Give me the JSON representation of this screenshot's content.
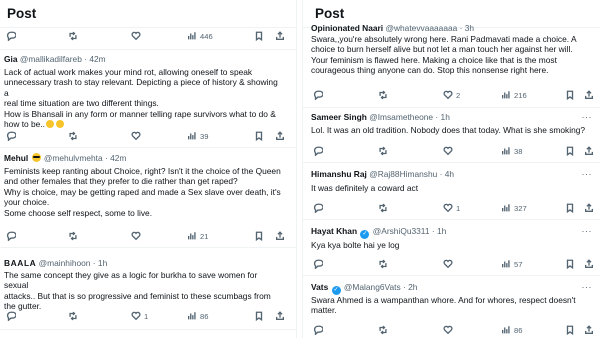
{
  "left": {
    "title": "Post",
    "top_actions": {
      "views": "446"
    },
    "posts": [
      {
        "name": "Gia",
        "handle": "@mallikadilfareb",
        "time": "42m",
        "lines": [
          "Lack of actual work makes your mind rot, allowing oneself to speak",
          "unnecessary trash to stay relevant. Depicting a piece of history & showing a",
          "real time situation are two different things.",
          "How is Bhansali in any form or manner telling rape survivors what to do &",
          "how to be.."
        ],
        "views": "39"
      },
      {
        "name": "Mehul",
        "handle": "@mehulvmehta",
        "time": "42m",
        "lines": [
          "Feminists keep ranting about Choice, right? Isn't it the choice of the Queen",
          "and other females that they prefer to die rather than get raped?",
          "Why is choice, may be getting raped and made a Sex slave over death, it's",
          "your choice.",
          "Some choose self respect, some to live."
        ],
        "views": "21"
      },
      {
        "name": "BAALA",
        "handle": "@mainhihoon",
        "time": "1h",
        "lines": [
          "The same concept they give as a logic for burkha to save women for sexual",
          "attacks.. But that is so progressive and feminist to these scumbags from",
          "the gutter."
        ],
        "likes": "1",
        "views": "86"
      }
    ]
  },
  "right": {
    "title": "Post",
    "top_post": {
      "name": "Opinionated Naari",
      "handle": "@whatevvaaaaaaa",
      "time": "3h",
      "lines": [
        "Swara,,you're absolutely wrong here. Rani Padmavati made a choice. A",
        "choice to burn herself alive but not let a man touch her against her will.",
        "Your feminism is flawed here. Making a choice like that is the most",
        "courageous thing anyone can do. Stop this nonsense right here."
      ],
      "likes": "2",
      "views": "216"
    },
    "posts": [
      {
        "name": "Sameer Singh",
        "handle": "@Imsametheone",
        "time": "1h",
        "lines": [
          "Lol. It was an old tradition. Nobody does that today. What is she smoking?"
        ],
        "views": "38"
      },
      {
        "name": "Himanshu Raj",
        "handle": "@Raj88Himanshu",
        "time": "4h",
        "lines": [
          "It was definitely a coward act"
        ],
        "likes": "1",
        "views": "327"
      },
      {
        "name": "Hayat Khan",
        "handle": "@ArshiQu3311",
        "time": "1h",
        "lines": [
          "Kya kya bolte hai ye log"
        ],
        "views": "57"
      },
      {
        "name": "Vats",
        "handle": "@Malang6Vats",
        "time": "2h",
        "lines": [
          "Swara Ahmed is a wampanthan whore. And for whores, respect doesn't",
          "matter."
        ],
        "views": "86"
      }
    ]
  },
  "colors": {
    "text": "#0f1419",
    "muted": "#536471",
    "verified": "#1d9bf0",
    "divider": "#eff3f4"
  },
  "icons": [
    "reply-icon",
    "retweet-icon",
    "like-icon",
    "views-icon",
    "bookmark-icon",
    "share-icon",
    "verified-badge-icon",
    "more-icon"
  ]
}
